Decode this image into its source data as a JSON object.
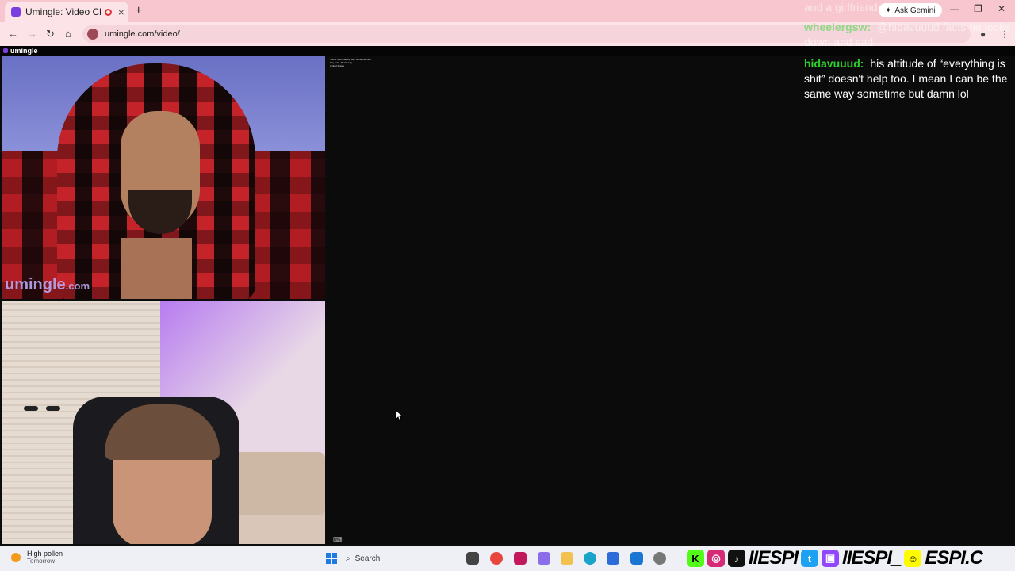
{
  "browser": {
    "tab_title": "Umingle: Video Chat with S",
    "new_tab": "+",
    "tab_close": "×",
    "ask_gemini": "Ask Gemini",
    "url": "umingle.com/video/",
    "window_controls": [
      "—",
      "❐",
      "✕"
    ]
  },
  "page": {
    "brand": "umingle",
    "watermark_main": "umingle",
    "watermark_suffix": ".com",
    "system_lines": [
      "You're now chatting with someone new",
      "Say hello. Be friendly",
      "United States"
    ]
  },
  "chat": {
    "messages": [
      {
        "user": "",
        "text": "and a girlfriend",
        "user_color": "#ffffff",
        "faded": true
      },
      {
        "user": "wheelergsw:",
        "text": "@hidavuuud facts he looks down and sad",
        "user_color": "#3ddc3d",
        "faded": true
      },
      {
        "user": "hidavuuud:",
        "text": "his attitude of “everything is shit” doesn't help too. I mean I can be the same way sometime but damn lol",
        "user_color": "#2fd12f",
        "faded": false
      }
    ]
  },
  "taskbar": {
    "weather_title": "High pollen",
    "weather_sub": "Tomorrow",
    "search_label": "Search",
    "social_handles": [
      "IIESPI",
      "IIESPI_",
      "ESPI.C"
    ]
  },
  "colors": {
    "tabstrip": "#f7c6cf",
    "toolbar": "#fbe3e8",
    "brand": "#7a3fe0",
    "chat_user_green": "#2fd12f"
  }
}
